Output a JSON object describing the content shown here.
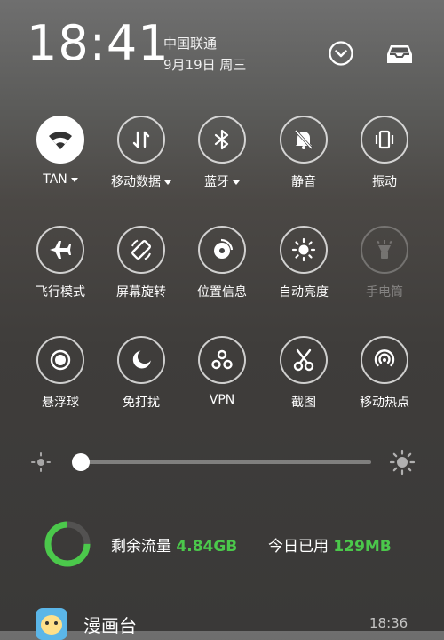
{
  "status": {
    "time": "18:41",
    "carrier": "中国联通",
    "date": "9月19日 周三"
  },
  "header": {
    "collapse_icon": "chevron-down-circle-icon",
    "inbox_icon": "tray-icon"
  },
  "toggles": [
    {
      "label": "TAN",
      "icon": "wifi-icon",
      "on": true,
      "dropdown": true
    },
    {
      "label": "移动数据",
      "icon": "mobile-data-icon",
      "on": false,
      "dropdown": true
    },
    {
      "label": "蓝牙",
      "icon": "bluetooth-icon",
      "on": false,
      "dropdown": true
    },
    {
      "label": "静音",
      "icon": "bell-off-icon",
      "on": false
    },
    {
      "label": "振动",
      "icon": "vibrate-icon",
      "on": false
    },
    {
      "label": "飞行模式",
      "icon": "airplane-icon",
      "on": false
    },
    {
      "label": "屏幕旋转",
      "icon": "rotate-icon",
      "on": false
    },
    {
      "label": "位置信息",
      "icon": "location-icon",
      "on": false
    },
    {
      "label": "自动亮度",
      "icon": "brightness-auto-icon",
      "on": false
    },
    {
      "label": "手电筒",
      "icon": "flashlight-icon",
      "on": false,
      "disabled": true
    },
    {
      "label": "悬浮球",
      "icon": "floating-ball-icon",
      "on": false
    },
    {
      "label": "免打扰",
      "icon": "moon-icon",
      "on": false
    },
    {
      "label": "VPN",
      "icon": "vpn-icon",
      "on": false
    },
    {
      "label": "截图",
      "icon": "scissors-icon",
      "on": false
    },
    {
      "label": "移动热点",
      "icon": "hotspot-icon",
      "on": false
    }
  ],
  "brightness": {
    "level": 0.0
  },
  "data_usage": {
    "remaining_label": "剩余流量",
    "remaining_value": "4.84GB",
    "today_label": "今日已用",
    "today_value": "129MB",
    "ring_color": "#4bc84b",
    "ring_fraction": 0.75
  },
  "notification": {
    "app_name": "漫画台",
    "time": "18:36"
  }
}
